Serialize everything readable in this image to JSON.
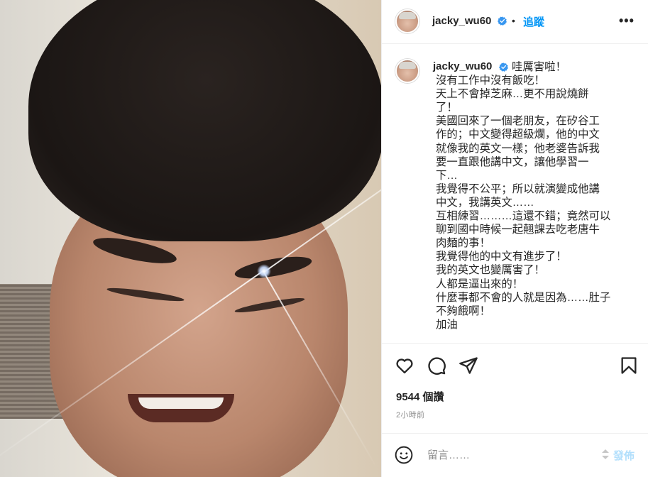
{
  "post": {
    "username": "jacky_wu60",
    "follow_label": "追蹤",
    "separator": "•",
    "more_label": "•••",
    "caption_lines": [
      "哇厲害啦！",
      "沒有工作中沒有飯吃！",
      "天上不會掉芝麻…更不用說燒餅",
      "了！",
      "美國回來了一個老朋友，在矽谷工",
      "作的；中文變得超級爛，他的中文",
      "就像我的英文一樣；他老婆告訴我",
      "要一直跟他講中文，讓他學習一",
      "下…",
      "我覺得不公平；所以就演變成他講",
      "中文，我講英文……",
      "互相練習………這還不錯；竟然可以",
      "聊到國中時候一起翹課去吃老唐牛",
      "肉麵的事！",
      "我覺得他的中文有進步了！",
      "我的英文也變厲害了！",
      "人都是逼出來的！",
      "什麼事都不會的人就是因為……肚子",
      "不夠餓啊！",
      "加油"
    ],
    "likes": "9544 個讚",
    "time_ago": "2小時前"
  },
  "comment": {
    "placeholder": "留言……",
    "post_label": "發佈"
  },
  "colors": {
    "accent": "#0095f6",
    "post_disabled": "#b2dffc",
    "verified": "#3897f0",
    "text": "#262626",
    "muted": "#8e8e8e",
    "border": "#efefef"
  },
  "icons": [
    "verified-badge-icon",
    "more-options-icon",
    "heart-icon",
    "comment-icon",
    "share-icon",
    "bookmark-icon",
    "emoji-icon"
  ]
}
